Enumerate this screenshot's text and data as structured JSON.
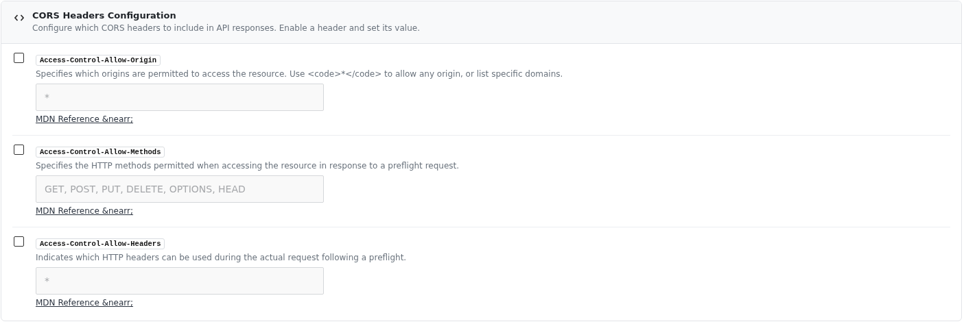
{
  "panel": {
    "title": "CORS Headers Configuration",
    "description": "Configure which CORS headers to include in API responses. Enable a header and set its value."
  },
  "headers": [
    {
      "name": "Access-Control-Allow-Origin",
      "checked": false,
      "description": "Specifies which origins are permitted to access the resource. Use <code>*</code> to allow any origin, or list specific domains.",
      "placeholder": "*",
      "link": "MDN Reference &nearr;"
    },
    {
      "name": "Access-Control-Allow-Methods",
      "checked": false,
      "description": "Specifies the HTTP methods permitted when accessing the resource in response to a preflight request.",
      "placeholder": "GET, POST, PUT, DELETE, OPTIONS, HEAD",
      "link": "MDN Reference &nearr;"
    },
    {
      "name": "Access-Control-Allow-Headers",
      "checked": false,
      "description": "Indicates which HTTP headers can be used during the actual request following a preflight.",
      "placeholder": "*",
      "link": "MDN Reference &nearr;"
    }
  ]
}
